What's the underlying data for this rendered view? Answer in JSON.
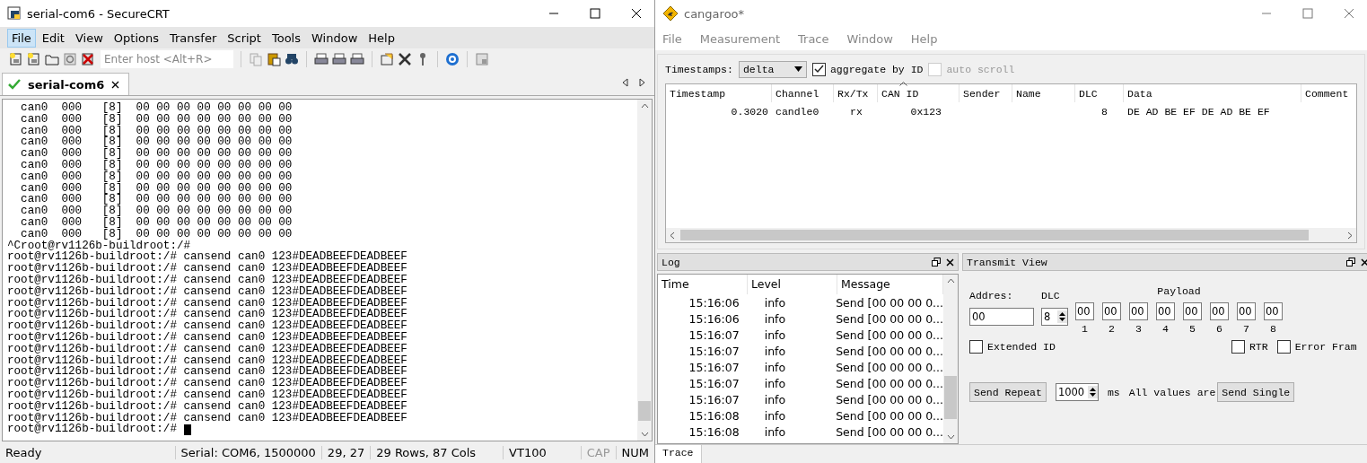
{
  "left": {
    "title": "serial-com6 - SecureCRT",
    "menu": [
      {
        "label": "File",
        "selected": true
      },
      {
        "label": "Edit",
        "selected": false
      },
      {
        "label": "View",
        "selected": false
      },
      {
        "label": "Options",
        "selected": false
      },
      {
        "label": "Transfer",
        "selected": false
      },
      {
        "label": "Script",
        "selected": false
      },
      {
        "label": "Tools",
        "selected": false
      },
      {
        "label": "Window",
        "selected": false
      },
      {
        "label": "Help",
        "selected": false
      }
    ],
    "host_field": {
      "placeholder": "Enter host <Alt+R>"
    },
    "tabs": [
      {
        "label": "serial-com6",
        "selected": true
      }
    ],
    "terminal": [
      "  can0  000   [8]  00 00 00 00 00 00 00 00",
      "  can0  000   [8]  00 00 00 00 00 00 00 00",
      "  can0  000   [8]  00 00 00 00 00 00 00 00",
      "  can0  000   [8]  00 00 00 00 00 00 00 00",
      "  can0  000   [8]  00 00 00 00 00 00 00 00",
      "  can0  000   [8]  00 00 00 00 00 00 00 00",
      "  can0  000   [8]  00 00 00 00 00 00 00 00",
      "  can0  000   [8]  00 00 00 00 00 00 00 00",
      "  can0  000   [8]  00 00 00 00 00 00 00 00",
      "  can0  000   [8]  00 00 00 00 00 00 00 00",
      "  can0  000   [8]  00 00 00 00 00 00 00 00",
      "  can0  000   [8]  00 00 00 00 00 00 00 00",
      "^Croot@rv1126b-buildroot:/#",
      "root@rv1126b-buildroot:/# cansend can0 123#DEADBEEFDEADBEEF",
      "root@rv1126b-buildroot:/# cansend can0 123#DEADBEEFDEADBEEF",
      "root@rv1126b-buildroot:/# cansend can0 123#DEADBEEFDEADBEEF",
      "root@rv1126b-buildroot:/# cansend can0 123#DEADBEEFDEADBEEF",
      "root@rv1126b-buildroot:/# cansend can0 123#DEADBEEFDEADBEEF",
      "root@rv1126b-buildroot:/# cansend can0 123#DEADBEEFDEADBEEF",
      "root@rv1126b-buildroot:/# cansend can0 123#DEADBEEFDEADBEEF",
      "root@rv1126b-buildroot:/# cansend can0 123#DEADBEEFDEADBEEF",
      "root@rv1126b-buildroot:/# cansend can0 123#DEADBEEFDEADBEEF",
      "root@rv1126b-buildroot:/# cansend can0 123#DEADBEEFDEADBEEF",
      "root@rv1126b-buildroot:/# cansend can0 123#DEADBEEFDEADBEEF",
      "root@rv1126b-buildroot:/# cansend can0 123#DEADBEEFDEADBEEF",
      "root@rv1126b-buildroot:/# cansend can0 123#DEADBEEFDEADBEEF",
      "root@rv1126b-buildroot:/# cansend can0 123#DEADBEEFDEADBEEF",
      "root@rv1126b-buildroot:/# cansend can0 123#DEADBEEFDEADBEEF",
      "root@rv1126b-buildroot:/#"
    ],
    "status_bar": [
      {
        "text": "Ready",
        "disabled": false
      },
      {
        "text": "Serial: COM6, 1500000",
        "disabled": false
      },
      {
        "text": "29,  27",
        "disabled": false
      },
      {
        "text": "29 Rows, 87 Cols",
        "disabled": false
      },
      {
        "text": "VT100",
        "disabled": false
      },
      {
        "text": "CAP",
        "disabled": true
      },
      {
        "text": "NUM",
        "disabled": false
      }
    ]
  },
  "right": {
    "title": "cangaroo*",
    "menu": [
      {
        "label": "File"
      },
      {
        "label": "Measurement"
      },
      {
        "label": "Trace"
      },
      {
        "label": "Window"
      },
      {
        "label": "Help"
      }
    ],
    "trace": {
      "timestamps_label": "Timestamps:",
      "timestamps_value": "delta",
      "options": [
        {
          "label": "aggregate by ID",
          "checked": true,
          "disabled": false
        },
        {
          "label": "auto scroll",
          "checked": false,
          "disabled": true
        }
      ],
      "columns": [
        {
          "label": "Timestamp",
          "sorted": false
        },
        {
          "label": "Channel",
          "sorted": false
        },
        {
          "label": "Rx/Tx",
          "sorted": false
        },
        {
          "label": "CAN ID",
          "sorted": true
        },
        {
          "label": "Sender",
          "sorted": false
        },
        {
          "label": "Name",
          "sorted": false
        },
        {
          "label": "DLC",
          "sorted": false
        },
        {
          "label": "Data",
          "sorted": false
        },
        {
          "label": "Comment",
          "sorted": false
        }
      ],
      "rows": [
        [
          "0.3020",
          "candle0",
          "rx",
          "0x123",
          "",
          "",
          "8",
          "DE AD BE EF DE AD BE EF",
          ""
        ]
      ]
    },
    "log": {
      "title": "Log",
      "columns": [
        "Time",
        "Level",
        "Message"
      ],
      "rows": [
        {
          "time": "15:16:06",
          "level": "info",
          "message": "Send [00 00 00 0..."
        },
        {
          "time": "15:16:06",
          "level": "info",
          "message": "Send [00 00 00 0..."
        },
        {
          "time": "15:16:07",
          "level": "info",
          "message": "Send [00 00 00 0..."
        },
        {
          "time": "15:16:07",
          "level": "info",
          "message": "Send [00 00 00 0..."
        },
        {
          "time": "15:16:07",
          "level": "info",
          "message": "Send [00 00 00 0..."
        },
        {
          "time": "15:16:07",
          "level": "info",
          "message": "Send [00 00 00 0..."
        },
        {
          "time": "15:16:07",
          "level": "info",
          "message": "Send [00 00 00 0..."
        },
        {
          "time": "15:16:08",
          "level": "info",
          "message": "Send [00 00 00 0..."
        },
        {
          "time": "15:16:08",
          "level": "info",
          "message": "Send [00 00 00 0..."
        }
      ]
    },
    "transmit": {
      "title": "Transmit View",
      "address_label": "Addres:",
      "address": "00",
      "dlc_label": "DLC",
      "dlc": "8",
      "payload_label": "Payload",
      "payload": [
        {
          "value": "00",
          "index": "1"
        },
        {
          "value": "00",
          "index": "2"
        },
        {
          "value": "00",
          "index": "3"
        },
        {
          "value": "00",
          "index": "4"
        },
        {
          "value": "00",
          "index": "5"
        },
        {
          "value": "00",
          "index": "6"
        },
        {
          "value": "00",
          "index": "7"
        },
        {
          "value": "00",
          "index": "8"
        }
      ],
      "extended": {
        "label": "Extended ID",
        "checked": false
      },
      "flags": [
        {
          "label": "RTR",
          "checked": false
        },
        {
          "label": "Error Fram",
          "checked": false
        }
      ],
      "send_repeat": "Send Repeat",
      "interval": "1000",
      "unit": "ms",
      "note": "All values are",
      "send_single": "Send Single"
    },
    "bottom_tabs": [
      {
        "label": "Trace",
        "selected": true
      }
    ]
  }
}
